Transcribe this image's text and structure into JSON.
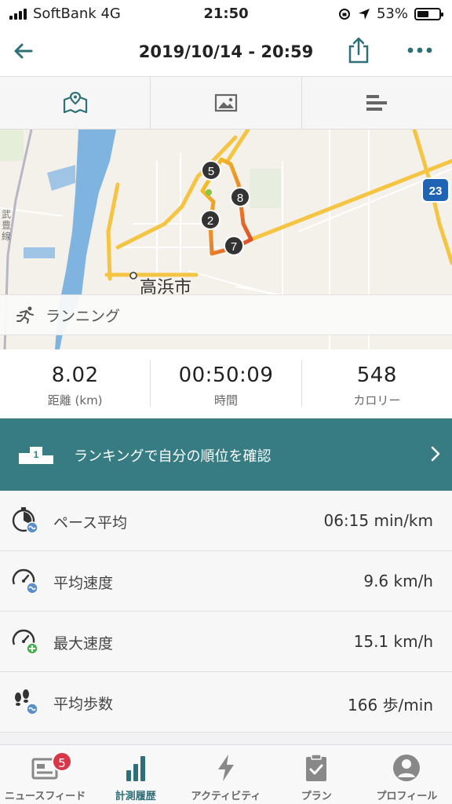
{
  "status": {
    "carrier": "SoftBank 4G",
    "time": "21:50",
    "battery": "53%",
    "battery_level": 0.53
  },
  "nav": {
    "title": "2019/10/14 - 20:59"
  },
  "map": {
    "city_label": "高浜市",
    "route_badge": "23",
    "side_label": "武豊線",
    "markers": [
      "5",
      "8",
      "2",
      "7"
    ]
  },
  "activity": {
    "label": "ランニング"
  },
  "stats": [
    {
      "value": "8.02",
      "label": "距離 (km)"
    },
    {
      "value": "00:50:09",
      "label": "時間"
    },
    {
      "value": "548",
      "label": "カロリー"
    }
  ],
  "ranking": {
    "podium_number": "1",
    "text": "ランキングで自分の順位を確認"
  },
  "metrics": [
    {
      "label": "ペース平均",
      "value": "06:15 min/km",
      "icon": "stopwatch-pace-icon"
    },
    {
      "label": "平均速度",
      "value": "9.6 km/h",
      "icon": "speedometer-average-icon"
    },
    {
      "label": "最大速度",
      "value": "15.1 km/h",
      "icon": "speedometer-max-icon"
    },
    {
      "label": "平均歩数",
      "value": "166 歩/min",
      "icon": "footsteps-icon"
    }
  ],
  "tabbar": {
    "items": [
      {
        "label": "ニュースフィード",
        "badge": "5"
      },
      {
        "label": "計測履歴"
      },
      {
        "label": "アクティビティ"
      },
      {
        "label": "プラン"
      },
      {
        "label": "プロフィール"
      }
    ]
  },
  "colors": {
    "accent": "#367c82",
    "badge": "#d9364a",
    "route_start": "#f5d327",
    "route_end": "#e0452a"
  }
}
